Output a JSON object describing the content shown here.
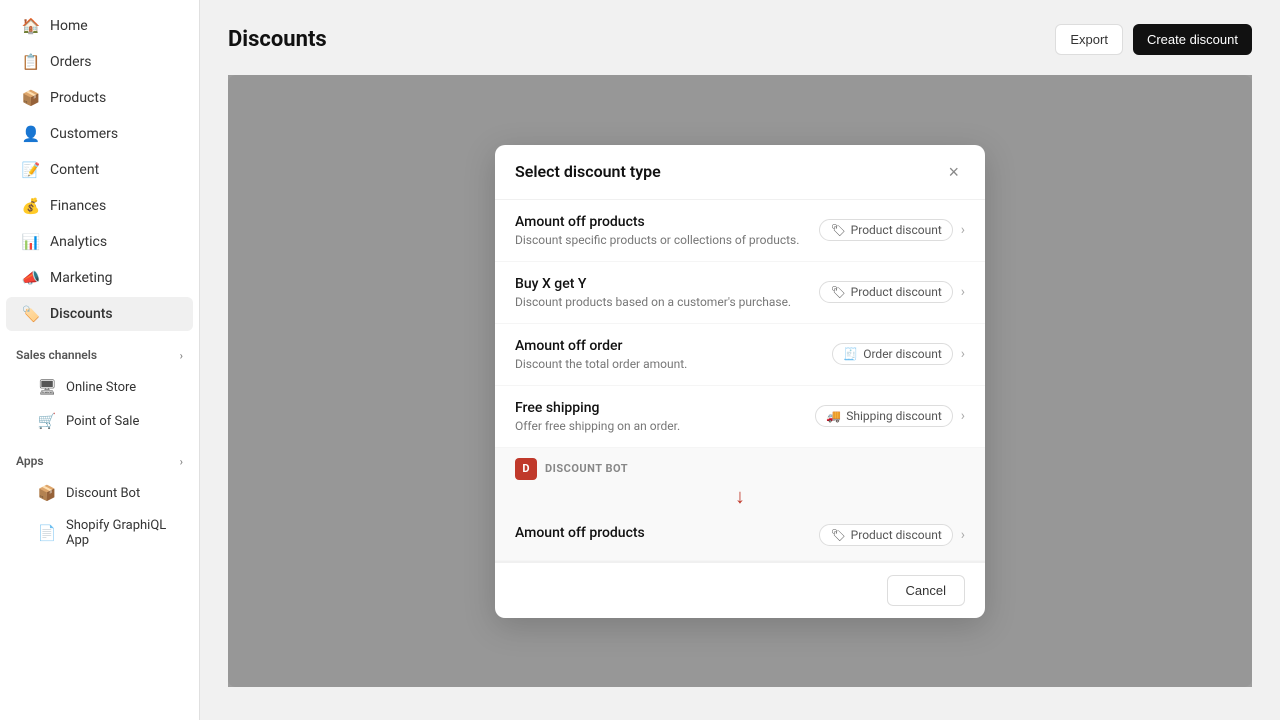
{
  "sidebar": {
    "items": [
      {
        "id": "home",
        "label": "Home",
        "icon": "🏠"
      },
      {
        "id": "orders",
        "label": "Orders",
        "icon": "📋"
      },
      {
        "id": "products",
        "label": "Products",
        "icon": "📦"
      },
      {
        "id": "customers",
        "label": "Customers",
        "icon": "👤"
      },
      {
        "id": "content",
        "label": "Content",
        "icon": "📝"
      },
      {
        "id": "finances",
        "label": "Finances",
        "icon": "💰"
      },
      {
        "id": "analytics",
        "label": "Analytics",
        "icon": "📊"
      },
      {
        "id": "marketing",
        "label": "Marketing",
        "icon": "📣"
      },
      {
        "id": "discounts",
        "label": "Discounts",
        "icon": "🏷️"
      }
    ],
    "sales_channels_label": "Sales channels",
    "sales_channels": [
      {
        "id": "online-store",
        "label": "Online Store",
        "icon": "🖥"
      },
      {
        "id": "point-of-sale",
        "label": "Point of Sale",
        "icon": "🛒"
      }
    ],
    "apps_label": "Apps",
    "apps": [
      {
        "id": "discount-bot",
        "label": "Discount Bot",
        "icon": "📦"
      },
      {
        "id": "graphiql",
        "label": "Shopify GraphiQL App",
        "icon": "📄"
      }
    ]
  },
  "header": {
    "page_title": "Discounts",
    "export_label": "Export",
    "create_discount_label": "Create discount"
  },
  "modal": {
    "title": "Select discount type",
    "close_label": "×",
    "items": [
      {
        "id": "amount-off-products",
        "title": "Amount off products",
        "description": "Discount specific products or collections of products.",
        "badge": "Product discount",
        "badge_icon": "🏷"
      },
      {
        "id": "buy-x-get-y",
        "title": "Buy X get Y",
        "description": "Discount products based on a customer's purchase.",
        "badge": "Product discount",
        "badge_icon": "🏷"
      },
      {
        "id": "amount-off-order",
        "title": "Amount off order",
        "description": "Discount the total order amount.",
        "badge": "Order discount",
        "badge_icon": "🧾"
      },
      {
        "id": "free-shipping",
        "title": "Free shipping",
        "description": "Offer free shipping on an order.",
        "badge": "Shipping discount",
        "badge_icon": "🚚"
      }
    ],
    "discount_bot_section": {
      "label": "DISCOUNT BOT",
      "icon_text": "D",
      "item_title": "Amount off products",
      "item_badge": "Product discount",
      "item_badge_icon": "🏷"
    },
    "cancel_label": "Cancel"
  }
}
